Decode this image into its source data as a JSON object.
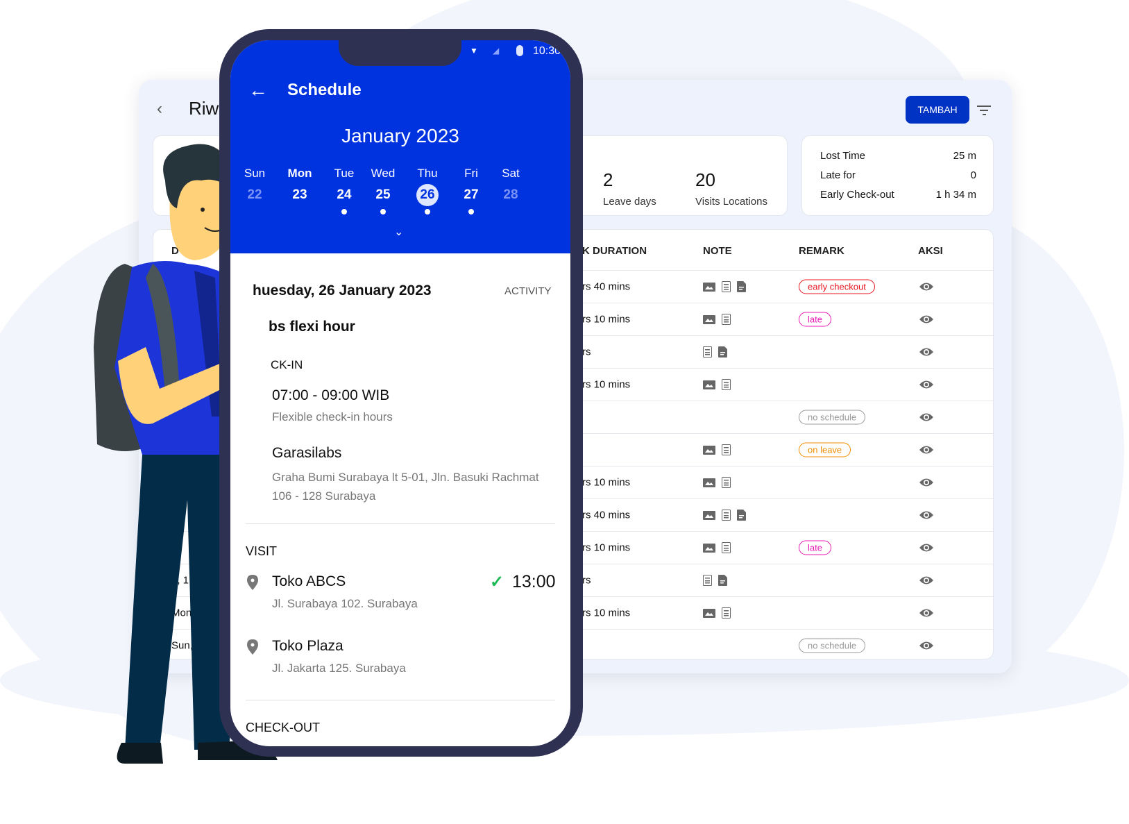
{
  "dashboard": {
    "title_partial": "Riwa",
    "add_button": "TAMBAH",
    "stats": {
      "leave_value": "2",
      "leave_label": "Leave days",
      "visits_value": "20",
      "visits_label": "Visits Locations"
    },
    "summary": [
      {
        "label": "Lost Time",
        "value": "25 m"
      },
      {
        "label": "Late for",
        "value": "0"
      },
      {
        "label": "Early Check-out",
        "value": "1 h 34 m"
      }
    ],
    "table": {
      "headers": {
        "date_partial": "D",
        "duration_partial": "K DURATION",
        "note": "NOTE",
        "remark": "REMARK",
        "action": "AKSI"
      },
      "rows": [
        {
          "date": "",
          "duration": "rs 40 mins",
          "notes": [
            "image",
            "doc",
            "file"
          ],
          "remark": "early checkout",
          "remark_color": "#e8141e"
        },
        {
          "date": "",
          "duration": "rs 10 mins",
          "notes": [
            "image",
            "doc"
          ],
          "remark": "late",
          "remark_color": "#e81ab4"
        },
        {
          "date": "",
          "duration": "rs",
          "notes": [
            "doc",
            "file"
          ],
          "remark": "",
          "remark_color": ""
        },
        {
          "date": "",
          "duration": "rs 10 mins",
          "notes": [
            "image",
            "doc"
          ],
          "remark": "",
          "remark_color": ""
        },
        {
          "date": "",
          "duration": "",
          "notes": [],
          "remark": "no schedule",
          "remark_color": "#999999"
        },
        {
          "date": "",
          "duration": "",
          "notes": [
            "image",
            "doc"
          ],
          "remark": "on leave",
          "remark_color": "#f08c00"
        },
        {
          "date": "",
          "duration": "rs 10 mins",
          "notes": [
            "image",
            "doc"
          ],
          "remark": "",
          "remark_color": ""
        },
        {
          "date": "",
          "duration": "rs 40 mins",
          "notes": [
            "image",
            "doc",
            "file"
          ],
          "remark": "",
          "remark_color": ""
        },
        {
          "date": "d,",
          "duration": "rs 10 mins",
          "notes": [
            "image",
            "doc"
          ],
          "remark": "late",
          "remark_color": "#e81ab4"
        },
        {
          "date": "e, 1",
          "duration": "rs",
          "notes": [
            "doc",
            "file"
          ],
          "remark": "",
          "remark_color": ""
        },
        {
          "date": "Mon, 1",
          "duration": "rs 10 mins",
          "notes": [
            "image",
            "doc"
          ],
          "remark": "",
          "remark_color": ""
        },
        {
          "date": "Sun, 1",
          "duration": "",
          "notes": [],
          "remark": "no schedule",
          "remark_color": "#999999"
        }
      ]
    }
  },
  "phone": {
    "status_time": "10:30",
    "title": "Schedule",
    "month": "January 2023",
    "days": [
      {
        "name": "Sun",
        "num": "22",
        "muted": true,
        "dot": false
      },
      {
        "name": "Mon",
        "num": "23",
        "muted": false,
        "dot": false
      },
      {
        "name": "Tue",
        "num": "24",
        "muted": false,
        "dot": true
      },
      {
        "name": "Wed",
        "num": "25",
        "muted": false,
        "dot": true
      },
      {
        "name": "Thu",
        "num": "26",
        "muted": false,
        "dot": true,
        "selected": true
      },
      {
        "name": "Fri",
        "num": "27",
        "muted": false,
        "dot": true
      },
      {
        "name": "Sat",
        "num": "28",
        "muted": true,
        "dot": false
      }
    ],
    "date_heading": "huesday, 26 January 2023",
    "activity_label": "ACTIVITY",
    "shift_name": "bs flexi hour",
    "checkin_label": "CK-IN",
    "checkin_time": "07:00 - 09:00 WIB",
    "checkin_note": "Flexible check-in hours",
    "office_name": "Garasilabs",
    "office_address": "Graha Bumi Surabaya lt 5-01, Jln. Basuki Rachmat 106 - 128 Surabaya",
    "visit_label": "VISIT",
    "visits": [
      {
        "name": "Toko ABCS",
        "address": "Jl. Surabaya 102. Surabaya",
        "time": "13:00",
        "done": true
      },
      {
        "name": "Toko Plaza",
        "address": "Jl. Jakarta 125. Surabaya",
        "time": "",
        "done": false
      }
    ],
    "checkout_label": "CHECK-OUT"
  },
  "colors": {
    "primary": "#0033e0",
    "button": "#0033c4",
    "phone_frame": "#2e3152",
    "check": "#1db954"
  }
}
